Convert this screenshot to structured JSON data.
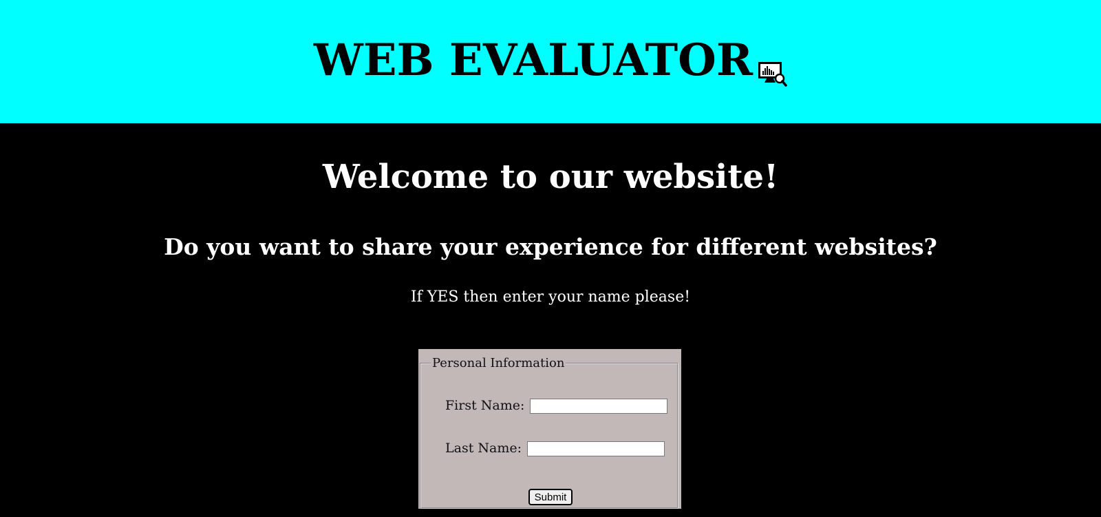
{
  "header": {
    "title": "WEB EVALUATOR",
    "logo_icon": "monitor-analytics-magnifier-icon",
    "background_color": "#00ffff"
  },
  "main": {
    "background_color": "#000000",
    "welcome": "Welcome to our website!",
    "question": "Do you want to share your experience for different websites?",
    "prompt": "If YES then enter your name please!"
  },
  "form": {
    "background_color": "#c2b8b8",
    "legend": "Personal Information",
    "first_name_label": "First Name:",
    "first_name_value": "",
    "last_name_label": "Last Name:",
    "last_name_value": "",
    "submit_label": "Submit"
  }
}
